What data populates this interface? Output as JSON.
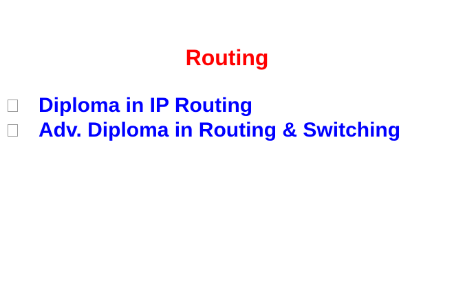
{
  "slide": {
    "title": "Routing",
    "title_color": "#ff0000",
    "bullet_color": "#0000ff",
    "bullets": [
      {
        "icon": "missing-glyph-box-icon",
        "text": "Diploma in IP Routing"
      },
      {
        "icon": "missing-glyph-box-icon",
        "text": "Adv. Diploma in Routing & Switching"
      }
    ]
  }
}
